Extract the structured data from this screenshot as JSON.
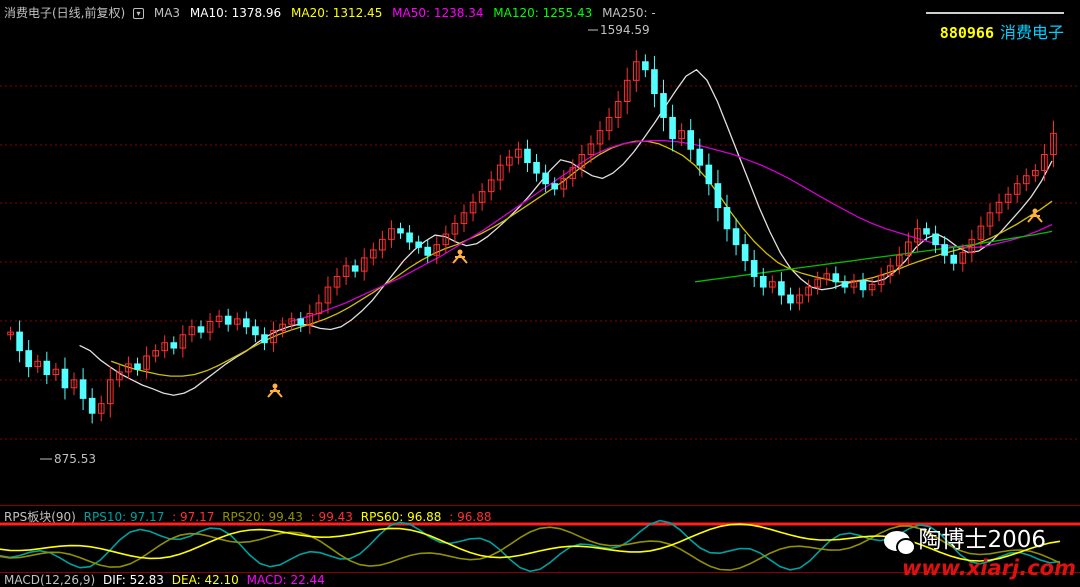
{
  "header": {
    "title": "消费电子(日线,前复权)",
    "ma_menu": "MA3",
    "ma10": "MA10: 1378.96",
    "ma20": "MA20: 1312.45",
    "ma50": "MA50: 1238.34",
    "ma120": "MA120: 1255.43",
    "ma250": "MA250: -"
  },
  "stock": {
    "code": "880966",
    "name": "消费电子"
  },
  "annotations": {
    "high": "1594.59",
    "low": "875.53"
  },
  "rps": {
    "title": "RPS板块(90)",
    "rps10": "RPS10: 97.17",
    "rps10_val": ": 97.17",
    "rps20": "RPS20: 99.43",
    "rps20_val": ": 99.43",
    "rps60": "RPS60: 96.88",
    "rps60_val": ": 96.88"
  },
  "macd": {
    "title": "MACD(12,26,9)",
    "dif": "DIF: 52.83",
    "dea": "DEA: 42.10",
    "macd": "MACD: 22.44"
  },
  "watermark": {
    "author": "陶博士2006",
    "url": "www.xiarj.com"
  },
  "colors": {
    "up": "#ff3030",
    "down": "#54ffff",
    "ma10": "#e0e0e0",
    "ma20": "#d0c000",
    "ma50": "#d000d0",
    "ma120": "#00c000",
    "rps10": "#00a0a0",
    "rps20": "#909000",
    "rps60": "#ffff00",
    "grid": "#8b0000"
  },
  "chart_data": {
    "type": "candlestick",
    "y_range": [
      820,
      1650
    ],
    "candles": [
      [
        1060,
        1065
      ],
      [
        1065,
        1030
      ],
      [
        1030,
        1000
      ],
      [
        1000,
        1010
      ],
      [
        1010,
        985
      ],
      [
        985,
        995
      ],
      [
        995,
        960
      ],
      [
        960,
        975
      ],
      [
        975,
        940
      ],
      [
        940,
        912
      ],
      [
        912,
        930
      ],
      [
        930,
        975
      ],
      [
        975,
        990
      ],
      [
        990,
        1005
      ],
      [
        1005,
        995
      ],
      [
        995,
        1020
      ],
      [
        1020,
        1030
      ],
      [
        1030,
        1045
      ],
      [
        1045,
        1035
      ],
      [
        1035,
        1060
      ],
      [
        1060,
        1075
      ],
      [
        1075,
        1065
      ],
      [
        1065,
        1085
      ],
      [
        1085,
        1095
      ],
      [
        1095,
        1080
      ],
      [
        1080,
        1090
      ],
      [
        1090,
        1075
      ],
      [
        1075,
        1060
      ],
      [
        1060,
        1045
      ],
      [
        1045,
        1068
      ],
      [
        1068,
        1080
      ],
      [
        1080,
        1090
      ],
      [
        1090,
        1078
      ],
      [
        1078,
        1100
      ],
      [
        1100,
        1120
      ],
      [
        1120,
        1150
      ],
      [
        1150,
        1170
      ],
      [
        1170,
        1190
      ],
      [
        1190,
        1180
      ],
      [
        1180,
        1205
      ],
      [
        1205,
        1220
      ],
      [
        1220,
        1240
      ],
      [
        1240,
        1260
      ],
      [
        1260,
        1252
      ],
      [
        1252,
        1235
      ],
      [
        1235,
        1225
      ],
      [
        1225,
        1210
      ],
      [
        1210,
        1230
      ],
      [
        1230,
        1250
      ],
      [
        1250,
        1270
      ],
      [
        1270,
        1290
      ],
      [
        1290,
        1310
      ],
      [
        1310,
        1330
      ],
      [
        1330,
        1352
      ],
      [
        1352,
        1380
      ],
      [
        1380,
        1395
      ],
      [
        1395,
        1410
      ],
      [
        1410,
        1385
      ],
      [
        1385,
        1365
      ],
      [
        1365,
        1345
      ],
      [
        1345,
        1335
      ],
      [
        1335,
        1355
      ],
      [
        1355,
        1375
      ],
      [
        1375,
        1400
      ],
      [
        1400,
        1420
      ],
      [
        1420,
        1445
      ],
      [
        1445,
        1470
      ],
      [
        1470,
        1500
      ],
      [
        1500,
        1540
      ],
      [
        1540,
        1575
      ],
      [
        1575,
        1560
      ],
      [
        1560,
        1515
      ],
      [
        1515,
        1470
      ],
      [
        1470,
        1430
      ],
      [
        1430,
        1445
      ],
      [
        1445,
        1410
      ],
      [
        1410,
        1380
      ],
      [
        1380,
        1345
      ],
      [
        1345,
        1300
      ],
      [
        1300,
        1260
      ],
      [
        1260,
        1230
      ],
      [
        1230,
        1200
      ],
      [
        1200,
        1170
      ],
      [
        1170,
        1150
      ],
      [
        1150,
        1160
      ],
      [
        1160,
        1135
      ],
      [
        1135,
        1120
      ],
      [
        1120,
        1135
      ],
      [
        1135,
        1150
      ],
      [
        1150,
        1165
      ],
      [
        1165,
        1175
      ],
      [
        1175,
        1160
      ],
      [
        1160,
        1150
      ],
      [
        1150,
        1162
      ],
      [
        1162,
        1145
      ],
      [
        1145,
        1155
      ],
      [
        1155,
        1172
      ],
      [
        1172,
        1190
      ],
      [
        1190,
        1210
      ],
      [
        1210,
        1235
      ],
      [
        1235,
        1260
      ],
      [
        1260,
        1250
      ],
      [
        1250,
        1230
      ],
      [
        1230,
        1210
      ],
      [
        1210,
        1195
      ],
      [
        1195,
        1215
      ],
      [
        1215,
        1240
      ],
      [
        1240,
        1265
      ],
      [
        1265,
        1290
      ],
      [
        1290,
        1310
      ],
      [
        1310,
        1325
      ],
      [
        1325,
        1345
      ],
      [
        1345,
        1360
      ],
      [
        1360,
        1370
      ],
      [
        1370,
        1400
      ],
      [
        1400,
        1440
      ]
    ],
    "ma10": [
      1040,
      1030,
      1012,
      998,
      985,
      975,
      965,
      958,
      950,
      946,
      950,
      960,
      975,
      990,
      1005,
      1018,
      1030,
      1045,
      1058,
      1068,
      1075,
      1080,
      1078,
      1072,
      1070,
      1075,
      1088,
      1105,
      1125,
      1150,
      1175,
      1200,
      1220,
      1236,
      1248,
      1245,
      1235,
      1228,
      1232,
      1245,
      1262,
      1280,
      1300,
      1322,
      1346,
      1370,
      1390,
      1385,
      1372,
      1360,
      1355,
      1365,
      1382,
      1405,
      1432,
      1460,
      1490,
      1520,
      1548,
      1560,
      1540,
      1500,
      1450,
      1400,
      1350,
      1300,
      1255,
      1215,
      1185,
      1165,
      1150,
      1145,
      1148,
      1155,
      1160,
      1163,
      1160,
      1165,
      1180,
      1200,
      1225,
      1242,
      1250,
      1240,
      1225,
      1215,
      1218,
      1232,
      1252,
      1274,
      1296,
      1320,
      1350,
      1388
    ],
    "ma20": [
      1010,
      1002,
      995,
      990,
      985,
      982,
      982,
      985,
      992,
      1002,
      1014,
      1026,
      1038,
      1050,
      1060,
      1068,
      1075,
      1082,
      1090,
      1100,
      1112,
      1126,
      1140,
      1155,
      1170,
      1186,
      1200,
      1212,
      1222,
      1230,
      1240,
      1250,
      1262,
      1275,
      1290,
      1305,
      1320,
      1335,
      1350,
      1368,
      1385,
      1400,
      1412,
      1420,
      1425,
      1425,
      1420,
      1410,
      1398,
      1380,
      1355,
      1325,
      1292,
      1262,
      1236,
      1214,
      1196,
      1184,
      1176,
      1170,
      1165,
      1160,
      1160,
      1163,
      1168,
      1175,
      1183,
      1192,
      1200,
      1207,
      1214,
      1220,
      1226,
      1234,
      1244,
      1256,
      1268,
      1282,
      1296,
      1312
    ],
    "ma50": [
      1085,
      1092,
      1100,
      1110,
      1120,
      1132,
      1144,
      1156,
      1168,
      1182,
      1196,
      1210,
      1226,
      1242,
      1258,
      1276,
      1294,
      1312,
      1330,
      1348,
      1366,
      1384,
      1400,
      1412,
      1420,
      1424,
      1426,
      1426,
      1424,
      1420,
      1414,
      1407,
      1400,
      1390,
      1380,
      1368,
      1355,
      1340,
      1325,
      1310,
      1296,
      1282,
      1270,
      1260,
      1252,
      1244,
      1236,
      1230,
      1226,
      1224,
      1226,
      1232,
      1238,
      1246,
      1256,
      1268
    ],
    "ma120": [
      1160,
      1165,
      1170,
      1175,
      1180,
      1185,
      1190,
      1195,
      1200,
      1205,
      1210,
      1215,
      1220,
      1225,
      1230,
      1236,
      1242,
      1248,
      1255
    ]
  }
}
